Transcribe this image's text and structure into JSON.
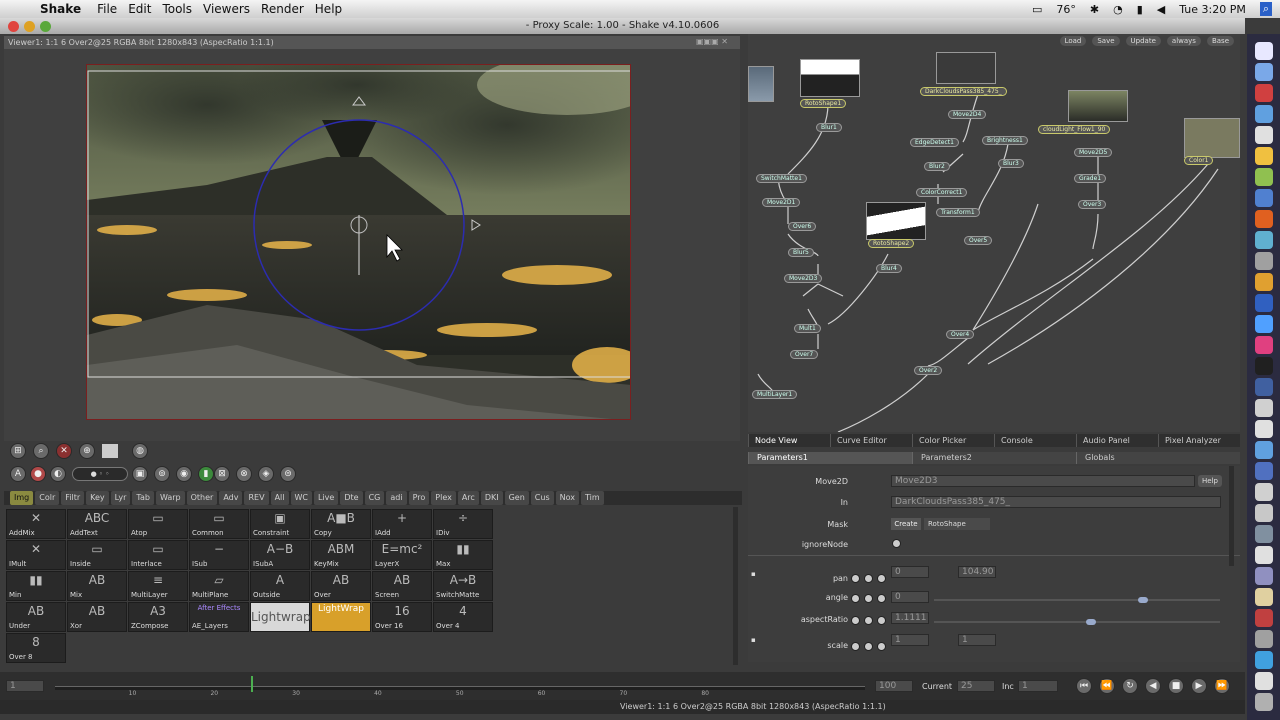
{
  "menubar": {
    "app": "Shake",
    "items": [
      "File",
      "Edit",
      "Tools",
      "Viewers",
      "Render",
      "Help"
    ],
    "temp": "76°",
    "clock": "Tue 3:20 PM"
  },
  "window": {
    "title": "- Proxy Scale: 1.00 - Shake v4.10.0606"
  },
  "viewer": {
    "header": "Viewer1: 1:1 6 Over2@25 RGBA 8bit 1280x843 (AspecRatio 1:1.1)"
  },
  "viewer_toolbar1": [
    "grid-icon",
    "zoom-icon",
    "compare-icon",
    "channel-icon",
    "swatch-icon",
    "color-icon"
  ],
  "tool_tabs": [
    "Img",
    "Colr",
    "Filtr",
    "Key",
    "Lyr",
    "Tab",
    "Warp",
    "Other",
    "Adv",
    "REV",
    "All",
    "WC",
    "Live",
    "Dte",
    "CG",
    "adi",
    "Pro",
    "Plex",
    "Arc",
    "DKI",
    "Gen",
    "Cus",
    "Nox",
    "Tim"
  ],
  "tool_tabs_active": 0,
  "tools": [
    {
      "label": "AddMix",
      "icon": "✕"
    },
    {
      "label": "AddText",
      "icon": "ABC"
    },
    {
      "label": "Atop",
      "icon": "▭"
    },
    {
      "label": "Common",
      "icon": "▭"
    },
    {
      "label": "Constraint",
      "icon": "▣"
    },
    {
      "label": "Copy",
      "icon": "A■B"
    },
    {
      "label": "IAdd",
      "icon": "+"
    },
    {
      "label": "IDiv",
      "icon": "÷"
    },
    {
      "label": "IMult",
      "icon": "✕"
    },
    {
      "label": "Inside",
      "icon": "▭"
    },
    {
      "label": "Interlace",
      "icon": "▭"
    },
    {
      "label": "ISub",
      "icon": "−"
    },
    {
      "label": "ISubA",
      "icon": "A−B"
    },
    {
      "label": "KeyMix",
      "icon": "ABM"
    },
    {
      "label": "LayerX",
      "icon": "E=mc²"
    },
    {
      "label": "Max",
      "icon": "▮▮"
    },
    {
      "label": "Min",
      "icon": "▮▮"
    },
    {
      "label": "Mix",
      "icon": "AB"
    },
    {
      "label": "MultiLayer",
      "icon": "≡"
    },
    {
      "label": "MultiPlane",
      "icon": "▱"
    },
    {
      "label": "Outside",
      "icon": "A"
    },
    {
      "label": "Over",
      "icon": "AB"
    },
    {
      "label": "Screen",
      "icon": "AB"
    },
    {
      "label": "SwitchMatte",
      "icon": "A→B"
    },
    {
      "label": "Under",
      "icon": "AB"
    },
    {
      "label": "Xor",
      "icon": "AB"
    },
    {
      "label": "ZCompose",
      "icon": "A3"
    },
    {
      "label": "AE_Layers",
      "icon": "After Effects"
    },
    {
      "label": "",
      "icon": "Lightwrap"
    },
    {
      "label": "",
      "icon": "LightWrap"
    },
    {
      "label": "Over 16",
      "icon": "16"
    },
    {
      "label": "Over 4",
      "icon": "4"
    },
    {
      "label": "Over 8",
      "icon": "8"
    }
  ],
  "nodeview": {
    "toolbar": [
      "Load",
      "Save",
      "Update",
      "always",
      "Base"
    ],
    "nodes": [
      "RotoShape1",
      "Blur1",
      "DarkCloudsPass385_475_",
      "Move2D4",
      "EdgeDetect1",
      "Brightness1",
      "Blur3",
      "Blur2",
      "ColorCorrect1",
      "Move2D5",
      "Grade1",
      "Over3",
      "Move2D1",
      "Over6",
      "RotoShape2",
      "Blur4",
      "Transform1",
      "Over5",
      "Over4",
      "MultiLayer1",
      "Over2",
      "cloudLight_Flow1_90",
      "Color1",
      "SwitchMatte1",
      "Blur5",
      "Move2D3",
      "Mult1",
      "Over7"
    ]
  },
  "panel_tabs": [
    "Node View",
    "Curve Editor",
    "Color Picker",
    "Console",
    "Audio Panel",
    "Pixel Analyzer"
  ],
  "param_tabs": [
    "Parameters1",
    "Parameters2",
    "Globals"
  ],
  "params": {
    "node_label": "Move2D",
    "node_value": "Move2D3",
    "help": "Help",
    "in_label": "In",
    "in_value": "DarkCloudsPass385_475_",
    "mask_label": "Mask",
    "mask_create": "Create",
    "mask_value": "RotoShape",
    "ignore_label": "ignoreNode",
    "pan_label": "pan",
    "pan_x": "0",
    "pan_y": "104.90",
    "angle_label": "angle",
    "angle_value": "0",
    "angle_level": 0.74,
    "aspect_label": "aspectRatio",
    "aspect_value": "1.1111",
    "aspect_level": 0.55,
    "scale_label": "scale",
    "scale_x": "1",
    "scale_y": "1"
  },
  "timeline": {
    "start": "1",
    "end": "100",
    "current_label": "Current",
    "current": "25",
    "inc_label": "Inc",
    "inc": "1",
    "ticks": [
      "10",
      "20",
      "30",
      "40",
      "50",
      "60",
      "70",
      "80"
    ]
  },
  "status": {
    "text": "Viewer1: 1:1 6 Over2@25 RGBA 8bit 1280x843 (AspecRatio 1:1.1)"
  },
  "colors": {
    "accent": "#8a8a40",
    "node_border": "#c9c96a"
  }
}
